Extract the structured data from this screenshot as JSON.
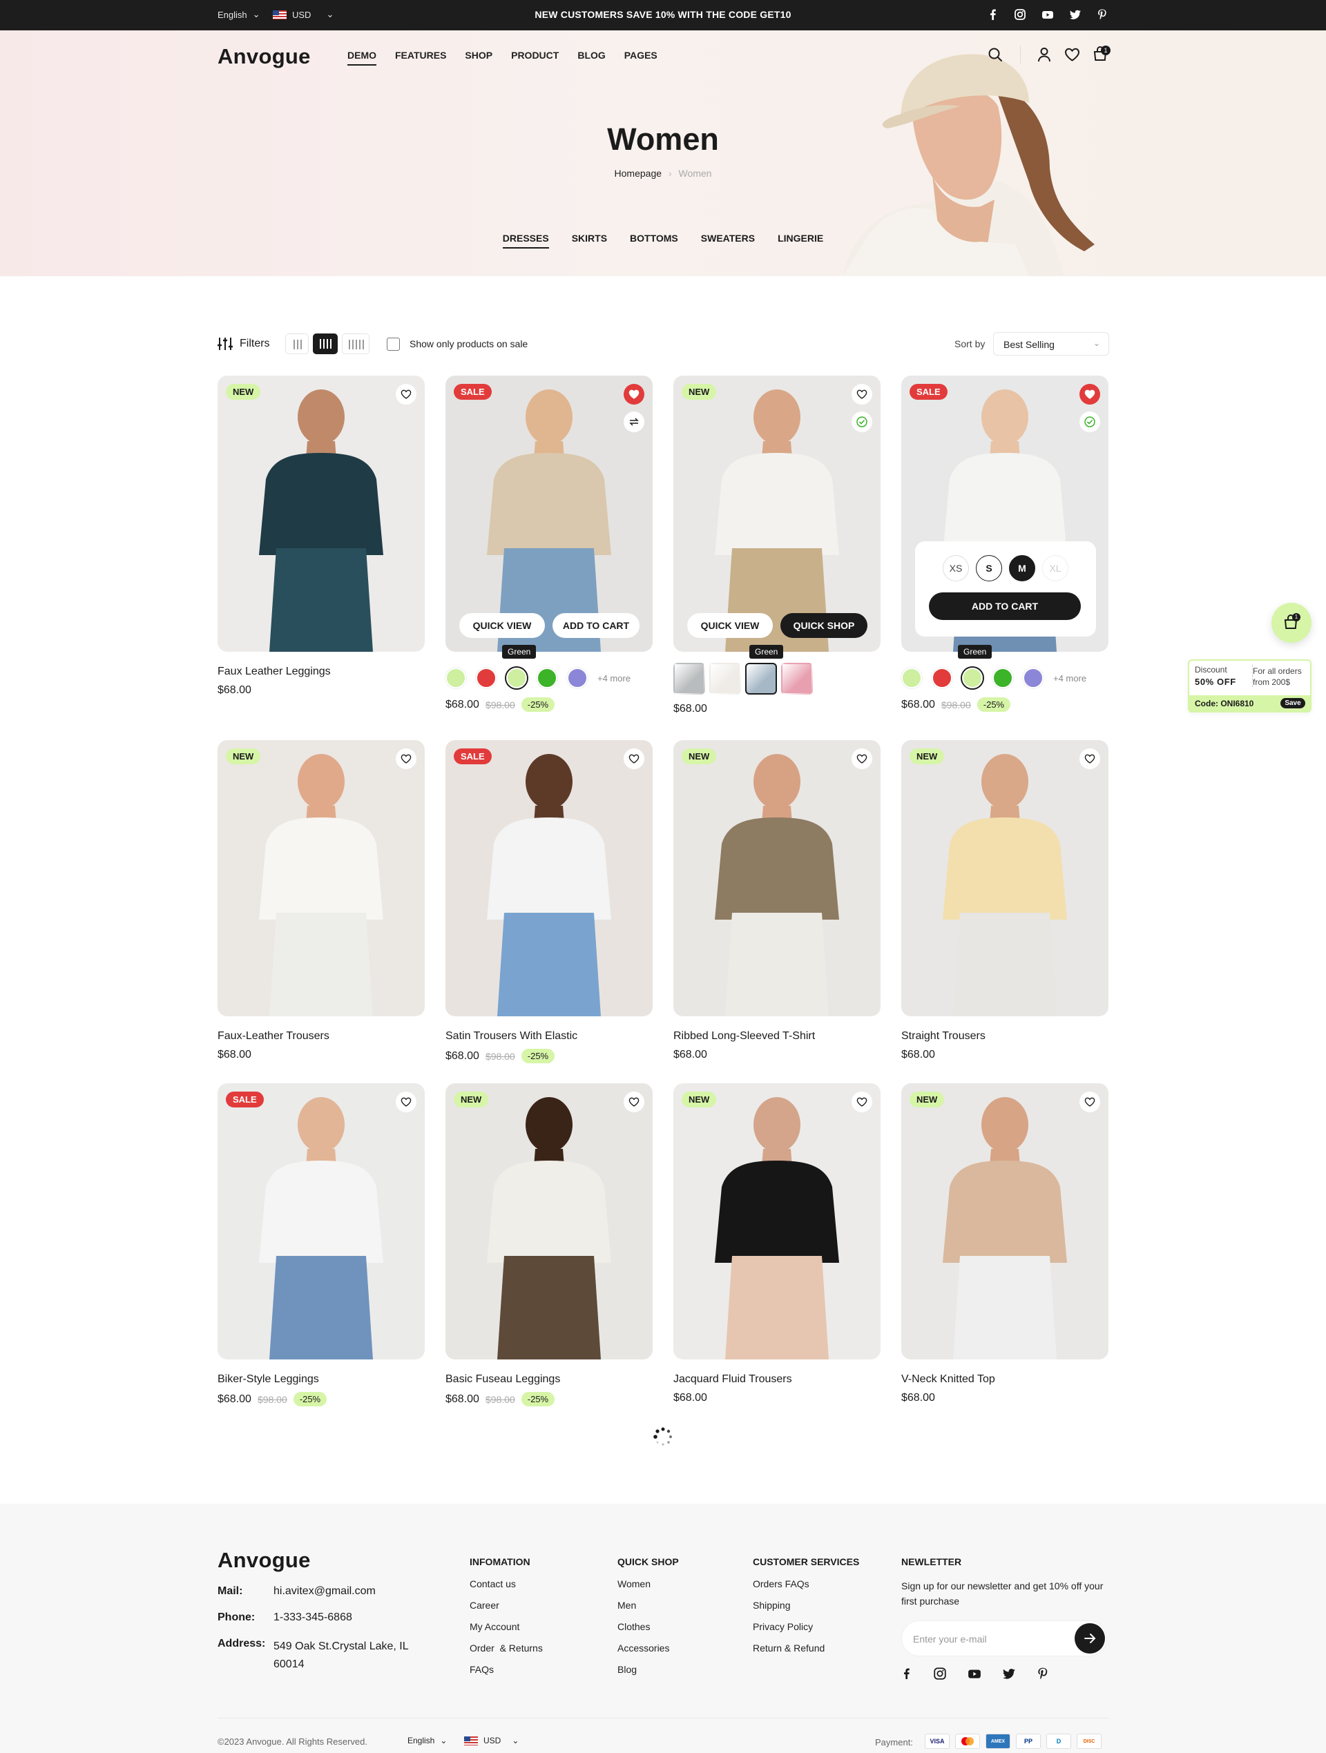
{
  "topbar": {
    "language": "English",
    "currency": "USD",
    "promo": "NEW CUSTOMERS SAVE 10% WITH THE CODE GET10",
    "social": [
      "facebook-icon",
      "instagram-icon",
      "youtube-icon",
      "twitter-icon",
      "pinterest-icon"
    ]
  },
  "header": {
    "logo": "Anvogue",
    "nav": [
      "DEMO",
      "FEATURES",
      "SHOP",
      "PRODUCT",
      "BLOG",
      "PAGES"
    ],
    "cart_count": "1"
  },
  "hero": {
    "title": "Women",
    "crumb_home": "Homepage",
    "crumb_current": "Women",
    "categories": [
      "DRESSES",
      "SKIRTS",
      "BOTTOMS",
      "SWEATERS",
      "LINGERIE"
    ]
  },
  "toolbar": {
    "filters": "Filters",
    "sale_only": "Show only products on sale",
    "sort_label": "Sort by",
    "sort_value": "Best Selling"
  },
  "colors": {
    "accent": "#d6f5a7",
    "sale": "#e23b3b",
    "dark": "#1b1b1b"
  },
  "products": [
    {
      "name": "Faux Leather Leggings",
      "price": "$68.00",
      "badge": "NEW",
      "bg": "#ecebe9"
    },
    {
      "name": "",
      "price": "$68.00",
      "old": "$98.00",
      "off": "-25%",
      "badge": "SALE",
      "bg": "#e4e3e1",
      "qv": "QUICK VIEW",
      "atc": "ADD TO CART",
      "tip": "Green",
      "more": "+4 more"
    },
    {
      "name": "",
      "price": "$68.00",
      "badge": "NEW",
      "bg": "#e9e8e6",
      "qv": "QUICK VIEW",
      "qs": "QUICK SHOP",
      "tip": "Green"
    },
    {
      "name": "",
      "price": "$68.00",
      "old": "$98.00",
      "off": "-25%",
      "badge": "SALE",
      "bg": "#e8e8e8",
      "sizes": [
        "XS",
        "S",
        "M",
        "XL"
      ],
      "atc": "ADD TO CART",
      "tip": "Green",
      "more": "+4 more"
    },
    {
      "name": "Faux-Leather Trousers",
      "price": "$68.00",
      "badge": "NEW",
      "bg": "#ebe7e3"
    },
    {
      "name": "Satin Trousers With Elastic",
      "price": "$68.00",
      "old": "$98.00",
      "off": "-25%",
      "badge": "SALE",
      "bg": "#e9e3df"
    },
    {
      "name": "Ribbed Long-Sleeved T-Shirt",
      "price": "$68.00",
      "badge": "NEW",
      "bg": "#e9e7e4"
    },
    {
      "name": "Straight Trousers",
      "price": "$68.00",
      "badge": "NEW",
      "bg": "#e8e7e5"
    },
    {
      "name": "Biker-Style Leggings",
      "price": "$68.00",
      "old": "$98.00",
      "off": "-25%",
      "badge": "SALE",
      "bg": "#ebebea"
    },
    {
      "name": "Basic Fuseau Leggings",
      "price": "$68.00",
      "old": "$98.00",
      "off": "-25%",
      "badge": "NEW",
      "bg": "#e7e6e3"
    },
    {
      "name": "Jacquard Fluid Trousers",
      "price": "$68.00",
      "badge": "NEW",
      "bg": "#ecebea"
    },
    {
      "name": "V-Neck Knitted Top",
      "price": "$68.00",
      "badge": "NEW",
      "bg": "#e9e8e6"
    }
  ],
  "discount": {
    "label": "Discount",
    "amount": "50% OFF",
    "cond_1": "For all orders",
    "cond_2": "from 200$",
    "code": "Code: ONI6810",
    "save": "Save"
  },
  "footer": {
    "logo": "Anvogue",
    "mail_label": "Mail:",
    "mail": "hi.avitex@gmail.com",
    "phone_label": "Phone:",
    "phone": "1-333-345-6868",
    "address_label": "Address:",
    "address_1": "549 Oak St.Crystal Lake, IL",
    "address_2": "60014",
    "info_title": "INFOMATION",
    "info": [
      "Contact us",
      "Career",
      "My Account",
      "Order  & Returns",
      "FAQs"
    ],
    "shop_title": "QUICK SHOP",
    "shop": [
      "Women",
      "Men",
      "Clothes",
      "Accessories",
      "Blog"
    ],
    "service_title": "CUSTOMER SERVICES",
    "service": [
      "Orders FAQs",
      "Shipping",
      "Privacy Policy",
      "Return & Refund"
    ],
    "news_title": "NEWLETTER",
    "news_1": "Sign up for our newsletter and get 10% off your",
    "news_2": "first purchase",
    "news_placeholder": "Enter your e-mail",
    "copyright": "©2023 Anvogue. All Rights Reserved.",
    "language": "English",
    "currency": "USD",
    "payment": "Payment:",
    "payments": [
      "VISA",
      "MC",
      "AMEX",
      "PP",
      "D",
      "DISC"
    ]
  }
}
